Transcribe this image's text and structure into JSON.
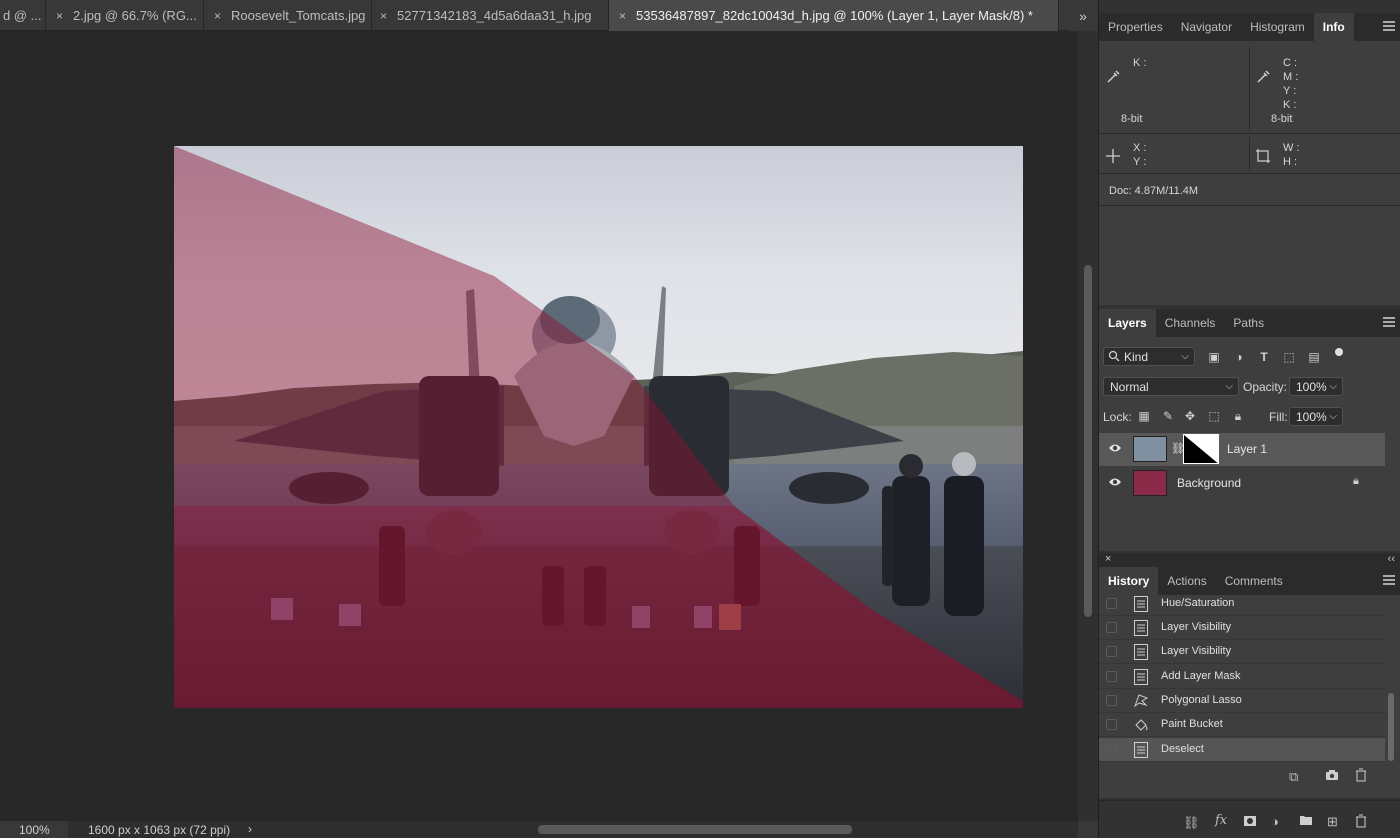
{
  "tabs": [
    {
      "label": "d @ ...",
      "closable": false,
      "active": false
    },
    {
      "label": "2.jpg @ 66.7% (RG...",
      "closable": true,
      "active": false
    },
    {
      "label": "Roosevelt_Tomcats.jpg",
      "closable": true,
      "active": false
    },
    {
      "label": "52771342183_4d5a6daa31_h.jpg",
      "closable": true,
      "active": false
    },
    {
      "label": "53536487897_82dc10043d_h.jpg @ 100% (Layer 1, Layer Mask/8) *",
      "closable": true,
      "active": true
    }
  ],
  "tab_close_glyph": "×",
  "tab_overflow_glyph": "»",
  "status": {
    "zoom": "100%",
    "doc_info": "1600 px x 1063 px (72 ppi)",
    "arrow": "›"
  },
  "info_panel": {
    "tabs": [
      "Properties",
      "Navigator",
      "Histogram",
      "Info"
    ],
    "active_tab": "Info",
    "left_labels": "K :",
    "right_labels": [
      "C :",
      "M :",
      "Y :",
      "K :"
    ],
    "bit_left": "8-bit",
    "bit_right": "8-bit",
    "xy_labels": [
      "X :",
      "Y :"
    ],
    "wh_labels": [
      "W :",
      "H :"
    ],
    "doc": "Doc: 4.87M/11.4M"
  },
  "layers_panel": {
    "tabs": [
      "Layers",
      "Channels",
      "Paths"
    ],
    "active_tab": "Layers",
    "filter_kind": "Kind",
    "blend_mode": "Normal",
    "opacity_label": "Opacity:",
    "opacity_value": "100%",
    "lock_label": "Lock:",
    "fill_label": "Fill:",
    "fill_value": "100%",
    "layers": [
      {
        "name": "Layer 1",
        "selected": true,
        "visible": true,
        "has_mask": true,
        "locked": false
      },
      {
        "name": "Background",
        "selected": false,
        "visible": true,
        "has_mask": false,
        "locked": true
      }
    ]
  },
  "history_panel": {
    "tabs": [
      "History",
      "Actions",
      "Comments"
    ],
    "active_tab": "History",
    "items": [
      {
        "label": "Hue/Saturation",
        "icon": "document-icon",
        "selected": false
      },
      {
        "label": "Layer Visibility",
        "icon": "document-icon",
        "selected": false
      },
      {
        "label": "Layer Visibility",
        "icon": "document-icon",
        "selected": false
      },
      {
        "label": "Add Layer Mask",
        "icon": "document-icon",
        "selected": false
      },
      {
        "label": "Polygonal Lasso",
        "icon": "lasso-icon",
        "selected": false
      },
      {
        "label": "Paint Bucket",
        "icon": "paint-bucket-icon",
        "selected": false
      },
      {
        "label": "Deselect",
        "icon": "document-icon",
        "selected": true
      }
    ]
  },
  "colors": {
    "mask_overlay": "#8c1030",
    "panel_bg": "#3e3e3e",
    "tab_active": "#4a4a4a"
  }
}
